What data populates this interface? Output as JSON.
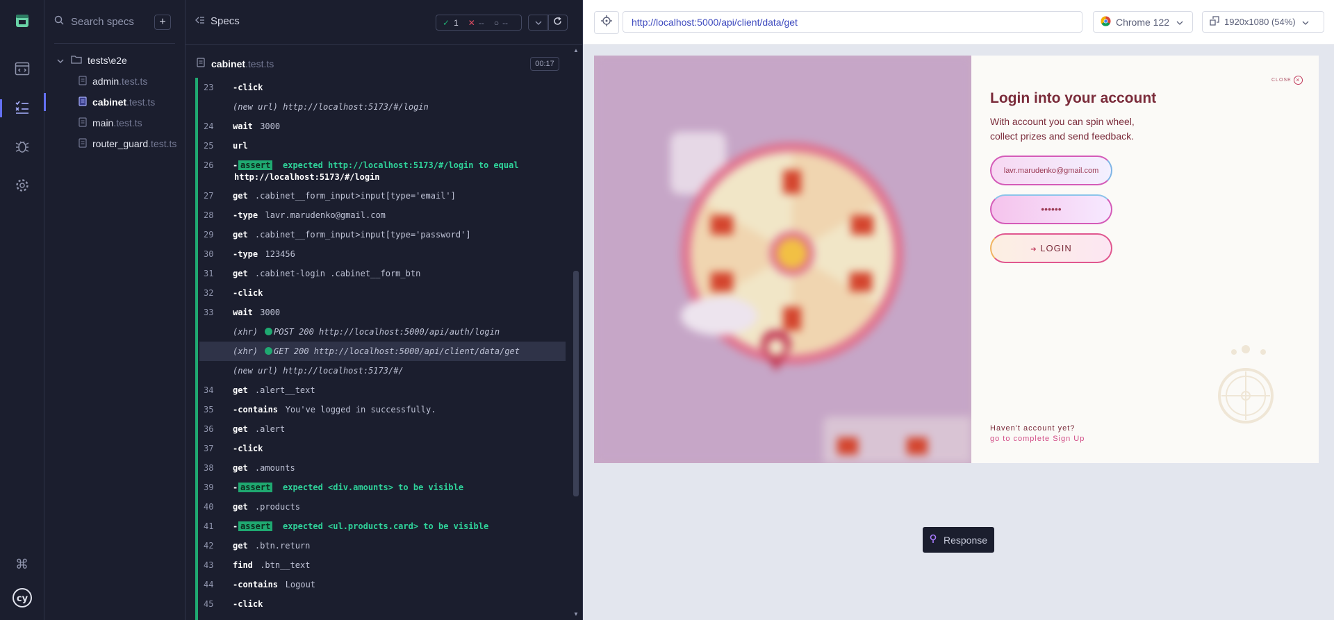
{
  "rail": {
    "icons": [
      "cypress-logo-icon",
      "runs-icon",
      "specs-list-icon",
      "debug-icon",
      "settings-icon",
      "keyboard-shortcuts-icon",
      "cypress-cy-icon"
    ]
  },
  "specs_panel": {
    "search_placeholder": "Search specs",
    "add_label": "+",
    "folder": "tests\\e2e",
    "files": [
      {
        "name": "admin",
        "ext": ".test.ts",
        "active": false
      },
      {
        "name": "cabinet",
        "ext": ".test.ts",
        "active": true
      },
      {
        "name": "main",
        "ext": ".test.ts",
        "active": false
      },
      {
        "name": "router_guard",
        "ext": ".test.ts",
        "active": false
      }
    ]
  },
  "reporter": {
    "title": "Specs",
    "passed": "1",
    "failed": "--",
    "pending": "--",
    "spec_name": "cabinet",
    "spec_ext": ".test.ts",
    "duration": "00:17",
    "commands": [
      {
        "num": "23",
        "cmd": "-click",
        "msg": ""
      },
      {
        "num": "",
        "cmd": "",
        "msg": "(new url)  http://localhost:5173/#/login",
        "type": "event"
      },
      {
        "num": "24",
        "cmd": "wait",
        "msg": "3000"
      },
      {
        "num": "25",
        "cmd": "url",
        "msg": ""
      },
      {
        "num": "26",
        "cmd": "-",
        "type": "assert",
        "tag": "assert",
        "msg": "expected http://localhost:5173/#/login to equal",
        "msg2": "http://localhost:5173/#/login"
      },
      {
        "num": "27",
        "cmd": "get",
        "msg": ".cabinet__form_input>input[type='email']"
      },
      {
        "num": "28",
        "cmd": "-type",
        "msg": "lavr.marudenko@gmail.com"
      },
      {
        "num": "29",
        "cmd": "get",
        "msg": ".cabinet__form_input>input[type='password']"
      },
      {
        "num": "30",
        "cmd": "-type",
        "msg": "123456"
      },
      {
        "num": "31",
        "cmd": "get",
        "msg": ".cabinet-login .cabinet__form_btn"
      },
      {
        "num": "32",
        "cmd": "-click",
        "msg": ""
      },
      {
        "num": "33",
        "cmd": "wait",
        "msg": "3000"
      },
      {
        "num": "",
        "cmd": "",
        "msg": "POST 200 http://localhost:5000/api/auth/login",
        "type": "xhr"
      },
      {
        "num": "",
        "cmd": "",
        "msg": "GET 200 http://localhost:5000/api/client/data/get",
        "type": "xhr",
        "highlight": true
      },
      {
        "num": "",
        "cmd": "",
        "msg": "(new url)  http://localhost:5173/#/",
        "type": "event"
      },
      {
        "num": "34",
        "cmd": "get",
        "msg": ".alert__text"
      },
      {
        "num": "35",
        "cmd": "-contains",
        "msg": "You've logged in successfully."
      },
      {
        "num": "36",
        "cmd": "get",
        "msg": ".alert"
      },
      {
        "num": "37",
        "cmd": "-click",
        "msg": ""
      },
      {
        "num": "38",
        "cmd": "get",
        "msg": ".amounts"
      },
      {
        "num": "39",
        "cmd": "-",
        "type": "assert",
        "tag": "assert",
        "msg": "expected <div.amounts> to be visible"
      },
      {
        "num": "40",
        "cmd": "get",
        "msg": ".products"
      },
      {
        "num": "41",
        "cmd": "-",
        "type": "assert",
        "tag": "assert",
        "msg": "expected <ul.products.card> to be visible"
      },
      {
        "num": "42",
        "cmd": "get",
        "msg": ".btn.return"
      },
      {
        "num": "43",
        "cmd": "find",
        "msg": ".btn__text"
      },
      {
        "num": "44",
        "cmd": "-contains",
        "msg": "Logout"
      },
      {
        "num": "45",
        "cmd": "-click",
        "msg": ""
      }
    ],
    "xhr_label": "(xhr)"
  },
  "aut": {
    "url": "http://localhost:5000/api/client/data/get",
    "browser": "Chrome 122",
    "viewport": "1920x1080 (54%)",
    "response_label": "Response"
  },
  "login": {
    "close_label": "CLOSE",
    "title": "Login into your account",
    "description": "With account you can spin wheel, collect prizes and send feedback.",
    "email_value": "lavr.marudenko@gmail.com",
    "password_value": "••••••",
    "login_button": "LOGIN",
    "no_account": "Haven't account yet?",
    "signup_link": "go to complete Sign Up"
  },
  "colors": {
    "accent": "#6470f3",
    "pass": "#1fa971",
    "brand_login": "#7a2b3a"
  }
}
